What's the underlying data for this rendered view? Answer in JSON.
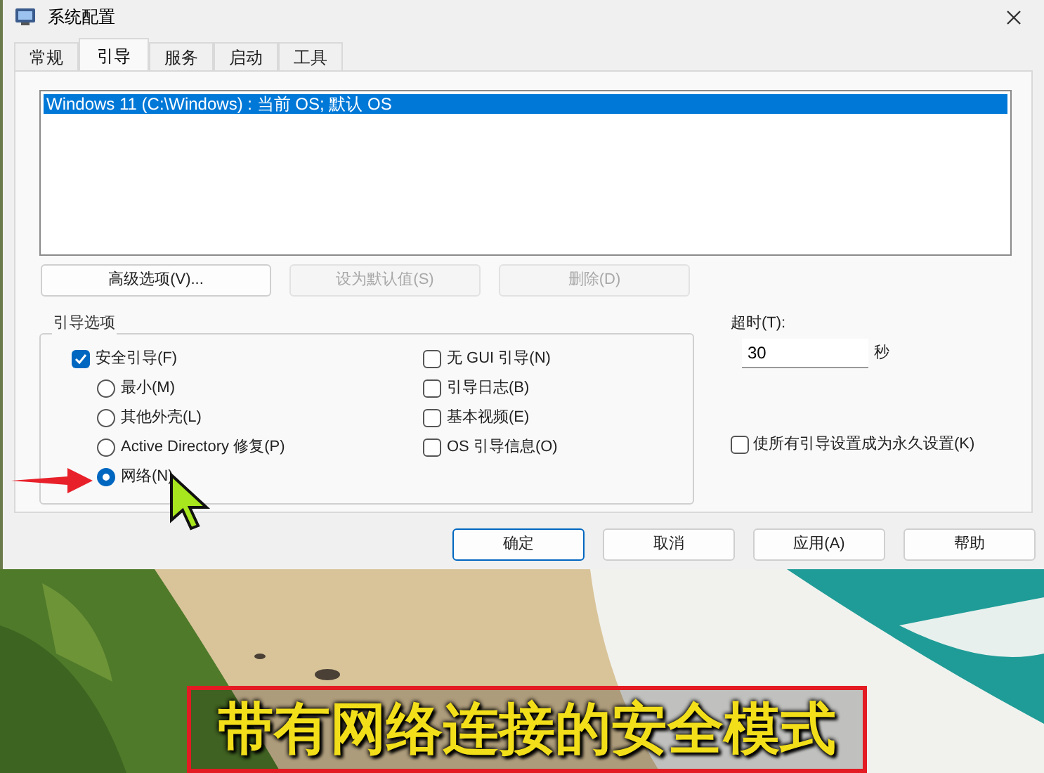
{
  "window": {
    "title": "系统配置"
  },
  "tabs": [
    {
      "label": "常规",
      "selected": false
    },
    {
      "label": "引导",
      "selected": true
    },
    {
      "label": "服务",
      "selected": false
    },
    {
      "label": "启动",
      "selected": false
    },
    {
      "label": "工具",
      "selected": false
    }
  ],
  "boot_list": [
    {
      "text": "Windows 11 (C:\\Windows) : 当前 OS; 默认 OS",
      "selected": true
    }
  ],
  "list_buttons": [
    {
      "label": "高级选项(V)...",
      "disabled": false
    },
    {
      "label": "设为默认值(S)",
      "disabled": true
    },
    {
      "label": "删除(D)",
      "disabled": true
    }
  ],
  "boot_options": {
    "title": "引导选项",
    "safe_boot": {
      "label": "安全引导(F)",
      "checked": true
    },
    "safe_modes": [
      {
        "label": "最小(M)",
        "selected": false
      },
      {
        "label": "其他外壳(L)",
        "selected": false
      },
      {
        "label": "Active Directory 修复(P)",
        "selected": false
      },
      {
        "label": "网络(N)",
        "selected": true
      }
    ],
    "flags": [
      {
        "label": "无 GUI 引导(N)",
        "checked": false
      },
      {
        "label": "引导日志(B)",
        "checked": false
      },
      {
        "label": "基本视频(E)",
        "checked": false
      },
      {
        "label": "OS 引导信息(O)",
        "checked": false
      }
    ]
  },
  "timeout": {
    "label": "超时(T):",
    "value": "30",
    "unit": "秒"
  },
  "permanent": {
    "label": "使所有引导设置成为永久设置(K)",
    "checked": false
  },
  "footer_buttons": [
    {
      "label": "确定",
      "default": true
    },
    {
      "label": "取消",
      "default": false
    },
    {
      "label": "应用(A)",
      "default": false
    },
    {
      "label": "帮助",
      "default": false
    }
  ],
  "caption": "带有网络连接的安全模式"
}
